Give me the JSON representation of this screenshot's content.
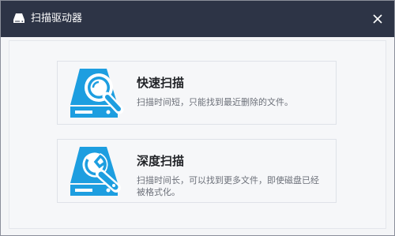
{
  "window": {
    "title": "扫描驱动器",
    "title_icon": "drive-icon",
    "close_icon": "close-icon"
  },
  "options": [
    {
      "title": "快速扫描",
      "description": "扫描时间短，只能找到最近删除的文件。",
      "icon": "drive-magnifier-icon"
    },
    {
      "title": "深度扫描",
      "description": "扫描时间长，可以找到更多文件，即使磁盘已经被格式化。",
      "icon": "drive-wrench-icon"
    }
  ],
  "colors": {
    "titlebar": "#2d3446",
    "accent": "#1d9ee0",
    "background": "#f4f5f7"
  }
}
